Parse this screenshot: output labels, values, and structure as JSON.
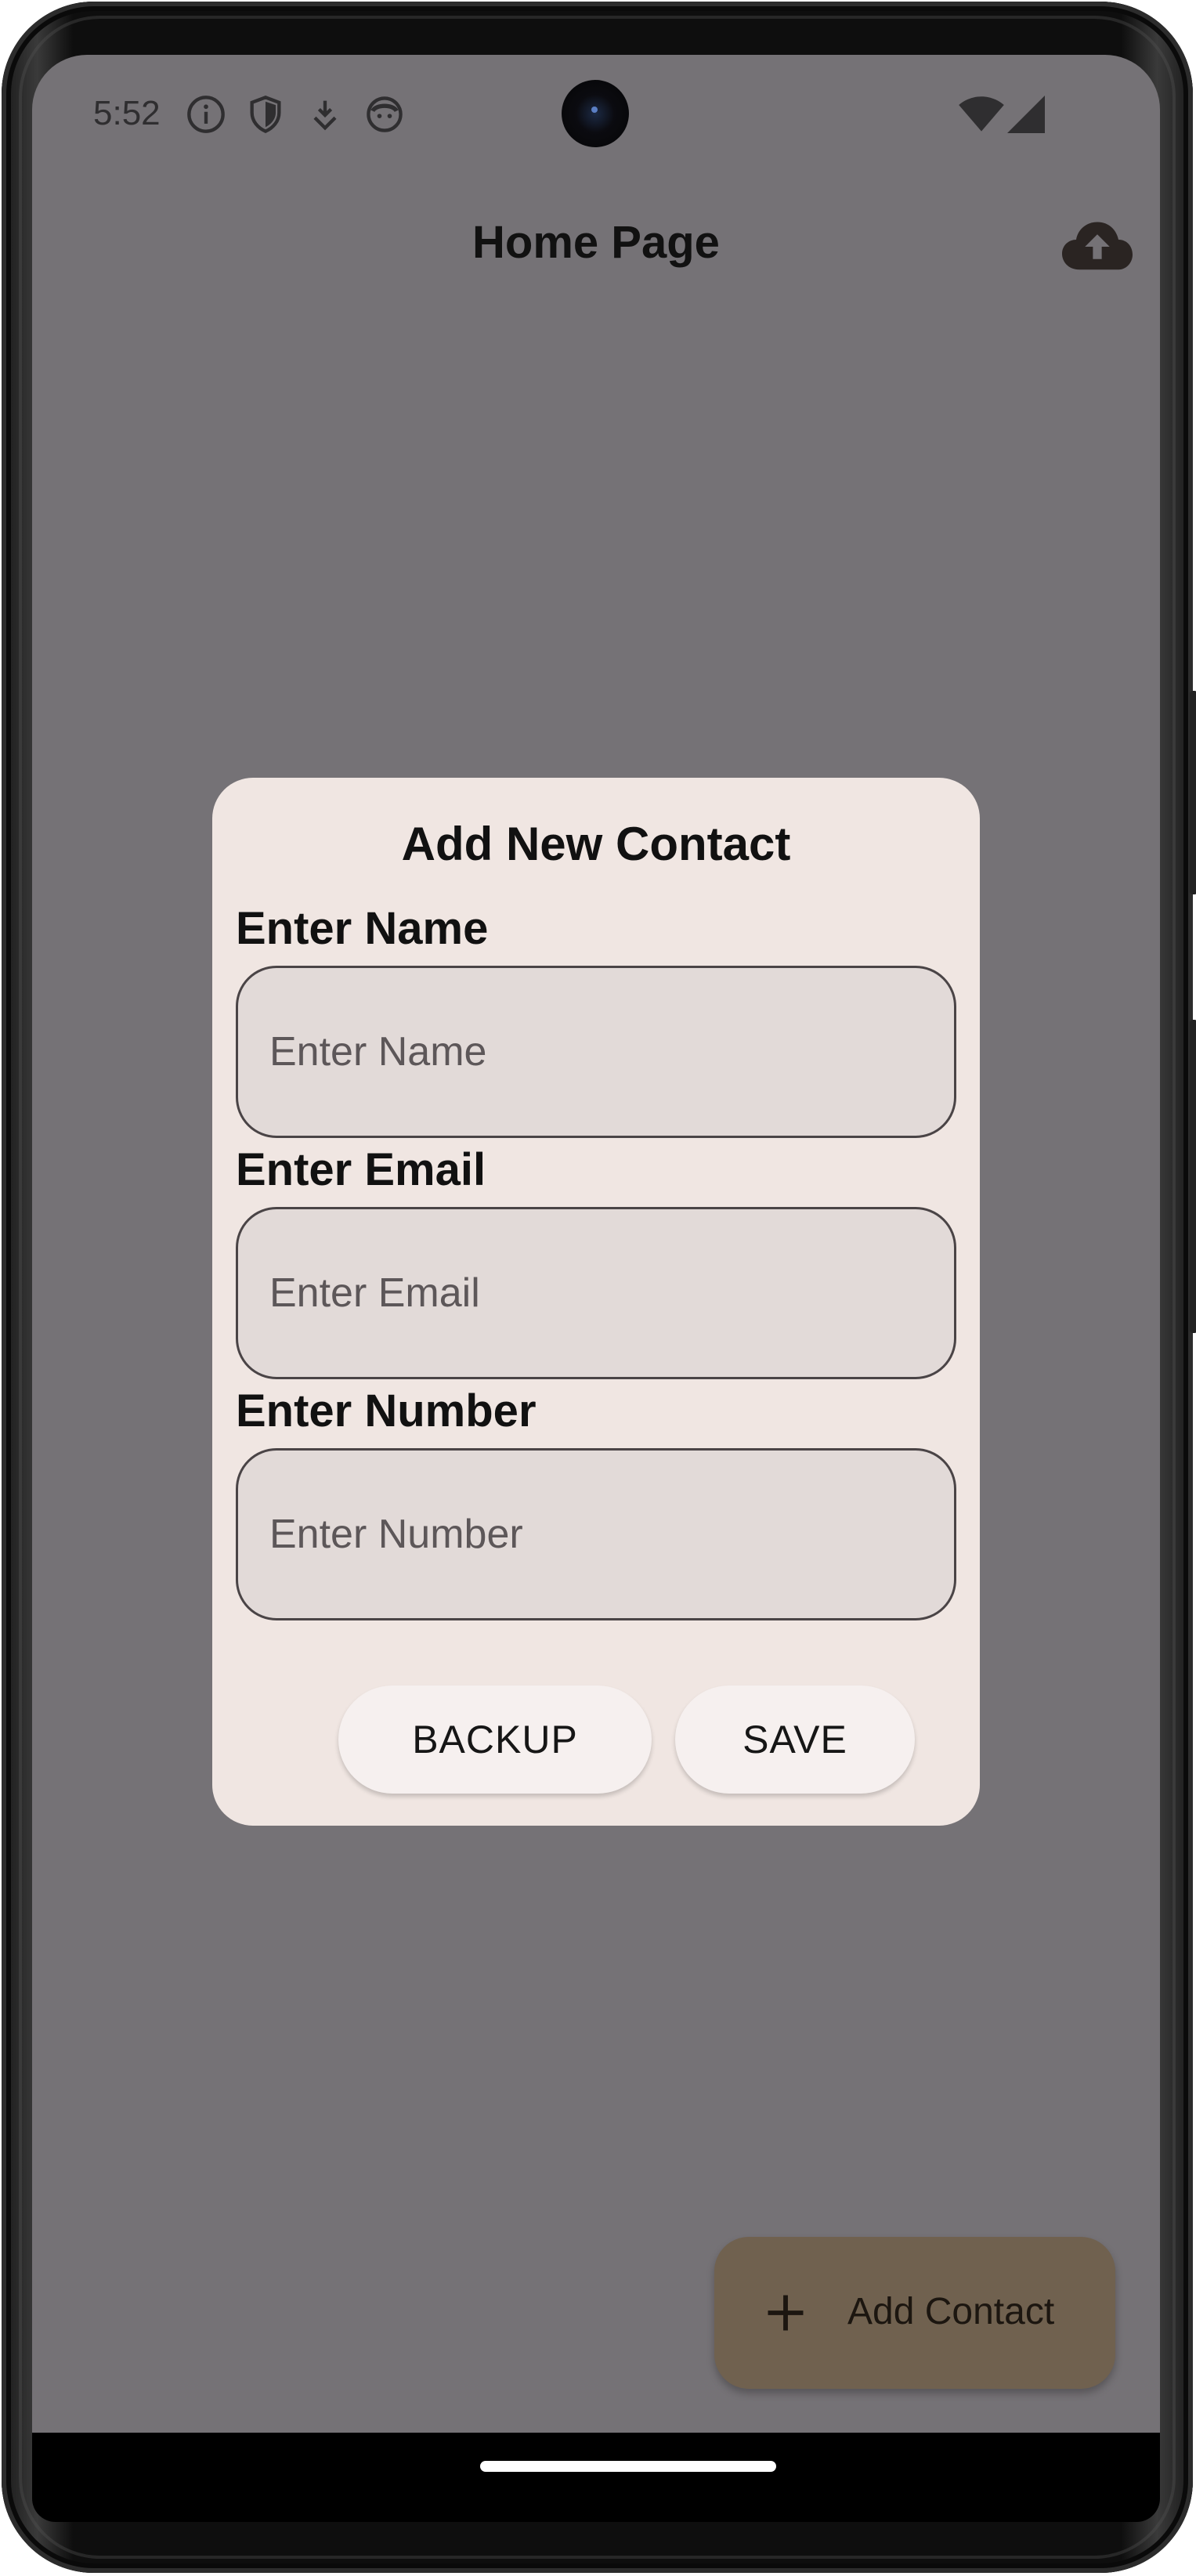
{
  "status_bar": {
    "time": "5:52",
    "icons": [
      "info-icon",
      "shield-icon",
      "download-icon",
      "face-icon"
    ],
    "right_icons": [
      "wifi-icon",
      "cellular-signal-icon"
    ]
  },
  "app_bar": {
    "title": "Home Page",
    "action_icon": "cloud-upload-icon"
  },
  "dialog": {
    "title": "Add New Contact",
    "fields": [
      {
        "label": "Enter Name",
        "placeholder": "Enter Name",
        "value": ""
      },
      {
        "label": "Enter Email",
        "placeholder": "Enter Email",
        "value": ""
      },
      {
        "label": "Enter Number",
        "placeholder": "Enter Number",
        "value": ""
      }
    ],
    "buttons": {
      "backup": "BACKUP",
      "save": "SAVE"
    }
  },
  "fab": {
    "label": "Add Contact",
    "icon": "plus-icon"
  },
  "colors": {
    "scrim_background": "#757276",
    "dialog_background": "#f0e6e2",
    "input_background": "#e2dad8",
    "fab_background": "#70614f"
  }
}
